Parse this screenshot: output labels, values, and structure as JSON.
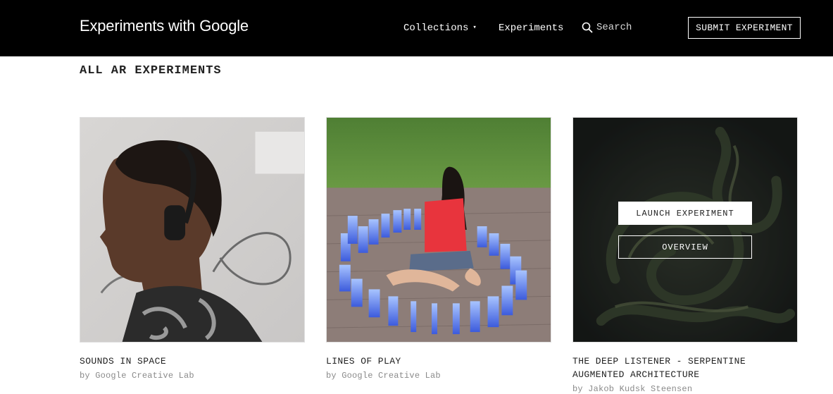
{
  "header": {
    "logo": "Experiments with Google",
    "nav": {
      "collections_label": "Collections",
      "collections_caret": "▾",
      "experiments_label": "Experiments",
      "search_label": "Search",
      "search_icon": "search-icon"
    },
    "submit_label": "SUBMIT EXPERIMENT",
    "background_color": "#000000"
  },
  "section": {
    "title": "ALL AR EXPERIMENTS"
  },
  "cards": [
    {
      "title": "SOUNDS IN SPACE",
      "author": "by Google Creative Lab"
    },
    {
      "title": "LINES OF PLAY",
      "author": "by Google Creative Lab"
    },
    {
      "title": "THE DEEP LISTENER - SERPENTINE AUGMENTED ARCHITECTURE",
      "author": "by Jakob Kudsk Steensen",
      "overlay": {
        "launch_label": "LAUNCH EXPERIMENT",
        "overview_label": "OVERVIEW"
      }
    }
  ]
}
